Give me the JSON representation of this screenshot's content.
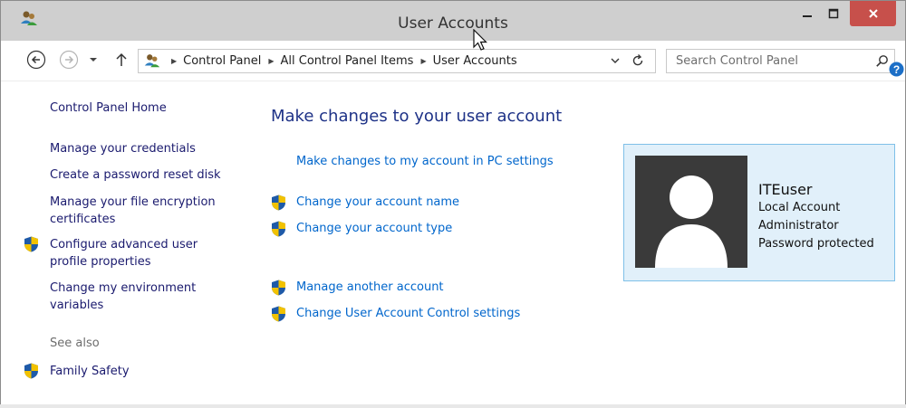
{
  "window": {
    "title": "User Accounts"
  },
  "nav": {
    "breadcrumbs": [
      "Control Panel",
      "All Control Panel Items",
      "User Accounts"
    ],
    "search_placeholder": "Search Control Panel"
  },
  "sidebar": {
    "home": "Control Panel Home",
    "links": [
      "Manage your credentials",
      "Create a password reset disk",
      "Manage your file encryption\ncertificates",
      "Configure advanced user\nprofile properties",
      "Change my environment\nvariables"
    ],
    "see_also_heading": "See also",
    "see_also": [
      "Family Safety"
    ]
  },
  "main": {
    "title": "Make changes to your user account",
    "pc_settings_link": "Make changes to my account in PC settings",
    "tasks": [
      "Change your account name",
      "Change your account type",
      "Manage another account",
      "Change User Account Control settings"
    ]
  },
  "account": {
    "name": "ITEuser",
    "type": "Local Account",
    "role": "Administrator",
    "security": "Password protected"
  },
  "colors": {
    "title_bar": "#cfcfcf",
    "close_button": "#c7504b",
    "link": "#0066cc",
    "heading": "#1e3287",
    "tile_bg": "#e1f0fa",
    "tile_border": "#7fc0e8"
  }
}
